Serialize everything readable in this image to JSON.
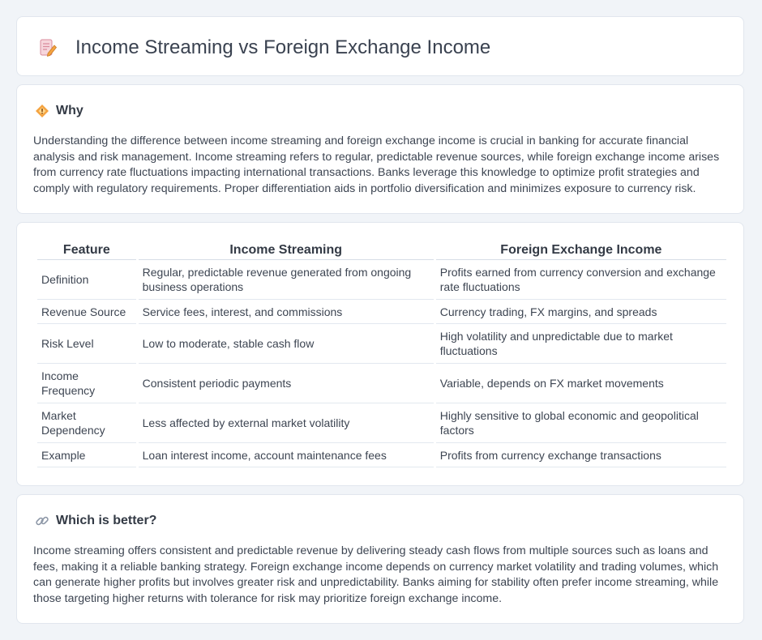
{
  "page": {
    "title": "Income Streaming vs Foreign Exchange Income",
    "icon": "document-pencil-icon"
  },
  "why": {
    "heading": "Why",
    "icon": "diamond-warning-icon",
    "text": "Understanding the difference between income streaming and foreign exchange income is crucial in banking for accurate financial analysis and risk management. Income streaming refers to regular, predictable revenue sources, while foreign exchange income arises from currency rate fluctuations impacting international transactions. Banks leverage this knowledge to optimize profit strategies and comply with regulatory requirements. Proper differentiation aids in portfolio diversification and minimizes exposure to currency risk."
  },
  "table": {
    "headers": [
      "Feature",
      "Income Streaming",
      "Foreign Exchange Income"
    ],
    "rows": [
      [
        "Definition",
        "Regular, predictable revenue generated from ongoing business operations",
        "Profits earned from currency conversion and exchange rate fluctuations"
      ],
      [
        "Revenue Source",
        "Service fees, interest, and commissions",
        "Currency trading, FX margins, and spreads"
      ],
      [
        "Risk Level",
        "Low to moderate, stable cash flow",
        "High volatility and unpredictable due to market fluctuations"
      ],
      [
        "Income Frequency",
        "Consistent periodic payments",
        "Variable, depends on FX market movements"
      ],
      [
        "Market Dependency",
        "Less affected by external market volatility",
        "Highly sensitive to global economic and geopolitical factors"
      ],
      [
        "Example",
        "Loan interest income, account maintenance fees",
        "Profits from currency exchange transactions"
      ]
    ]
  },
  "better": {
    "heading": "Which is better?",
    "icon": "link-icon",
    "text": "Income streaming offers consistent and predictable revenue by delivering steady cash flows from multiple sources such as loans and fees, making it a reliable banking strategy. Foreign exchange income depends on currency market volatility and trading volumes, which can generate higher profits but involves greater risk and unpredictability. Banks aiming for stability often prefer income streaming, while those targeting higher returns with tolerance for risk may prioritize foreign exchange income."
  },
  "colors": {
    "background": "#f1f4f8",
    "card": "#ffffff",
    "border": "#e1e6ee",
    "text": "#333a45",
    "icon_orange": "#f4a340",
    "icon_pink": "#e88ca0"
  }
}
